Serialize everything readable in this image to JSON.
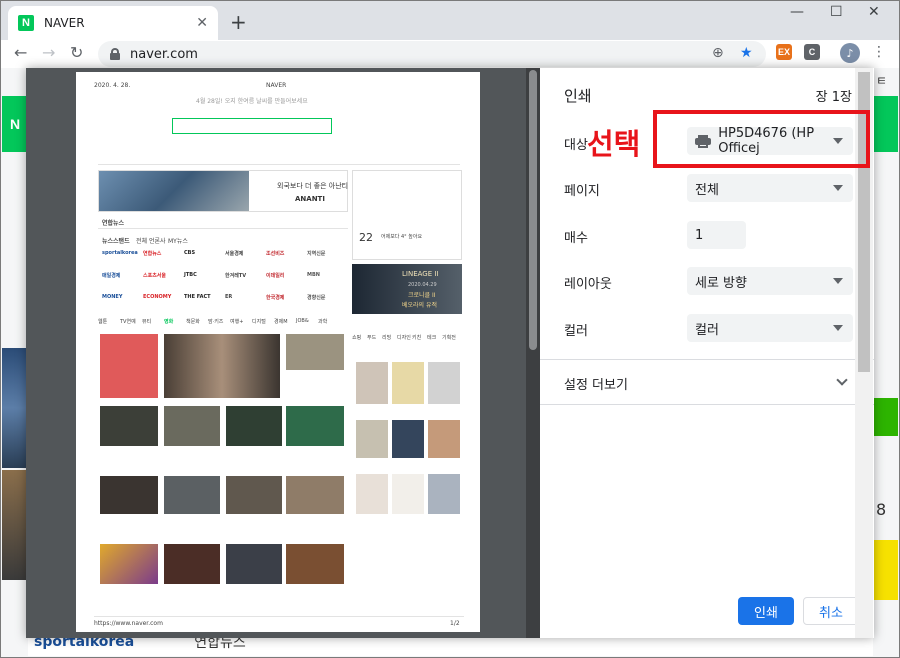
{
  "browser": {
    "tab_title": "NAVER",
    "tab_favicon": "N",
    "url": "naver.com",
    "ext1": "EX",
    "ext2": "C"
  },
  "underpage": {
    "left_logo": "N",
    "right_peek": "8",
    "right_top_peek": "ㅌ",
    "bottom_items": [
      "sportalkorea",
      "연합뉴스",
      "",
      ""
    ]
  },
  "sheet": {
    "date": "2020. 4. 28.",
    "site": "NAVER",
    "footer_url": "https://www.naver.com",
    "footer_page": "1/2",
    "banner_line1": "외국보다 더 좋은 아난티",
    "banner_brand": "ANANTI",
    "weather_temp": "22",
    "weather_desc": "어제보다 4° 높아요",
    "ad_title": "LINEAGE II",
    "ad_sub1": "크로니클 II",
    "ad_sub2": "베오라의 유적",
    "ad_date": "2020.04.29",
    "press_tabs": [
      "뉴스스탠드",
      "전체 언론사",
      "MY뉴스"
    ],
    "press": [
      "sportalkorea",
      "연합뉴스",
      "CBS",
      "서울경제",
      "조선비즈",
      "지역신문",
      "매일경제",
      "스포츠서울",
      "JTBC",
      "한겨레TV",
      "이데일리",
      "MBN",
      "MONEY",
      "ECONOMY",
      "THE FACT",
      "ER",
      "한국경제",
      "경향신문"
    ],
    "cat_tabs": [
      "웹툰",
      "TV연예",
      "뷰티",
      "영화",
      "책문화",
      "맘·키즈",
      "여행+",
      "디지털",
      "경제M",
      "JOB&",
      "과학"
    ],
    "shop_tabs": [
      "쇼핑",
      "푸드",
      "리빙",
      "디자인",
      "키친",
      "테크",
      "기획전"
    ],
    "link_line": "연합뉴스  연합뉴스",
    "search_hint": "4월 28일! 오지 한여름 날씨를 만들어보세요",
    "news_title": "연합뉴스"
  },
  "print": {
    "title": "인쇄",
    "page_count": "장 1장",
    "destination_label": "대상",
    "destination_value": "HP5D4676 (HP Officej",
    "pages_label": "페이지",
    "pages_value": "전체",
    "copies_label": "매수",
    "copies_value": "1",
    "layout_label": "레이아웃",
    "layout_value": "세로 방향",
    "color_label": "컬러",
    "color_value": "컬러",
    "more_settings": "설정 더보기",
    "print_button": "인쇄",
    "cancel_button": "취소"
  },
  "annotation": {
    "text": "선택",
    "color": "#e8141a"
  },
  "colors": {
    "accent": "#1a73e8",
    "naver_green": "#03c75a",
    "annotation_red": "#e8141a"
  }
}
